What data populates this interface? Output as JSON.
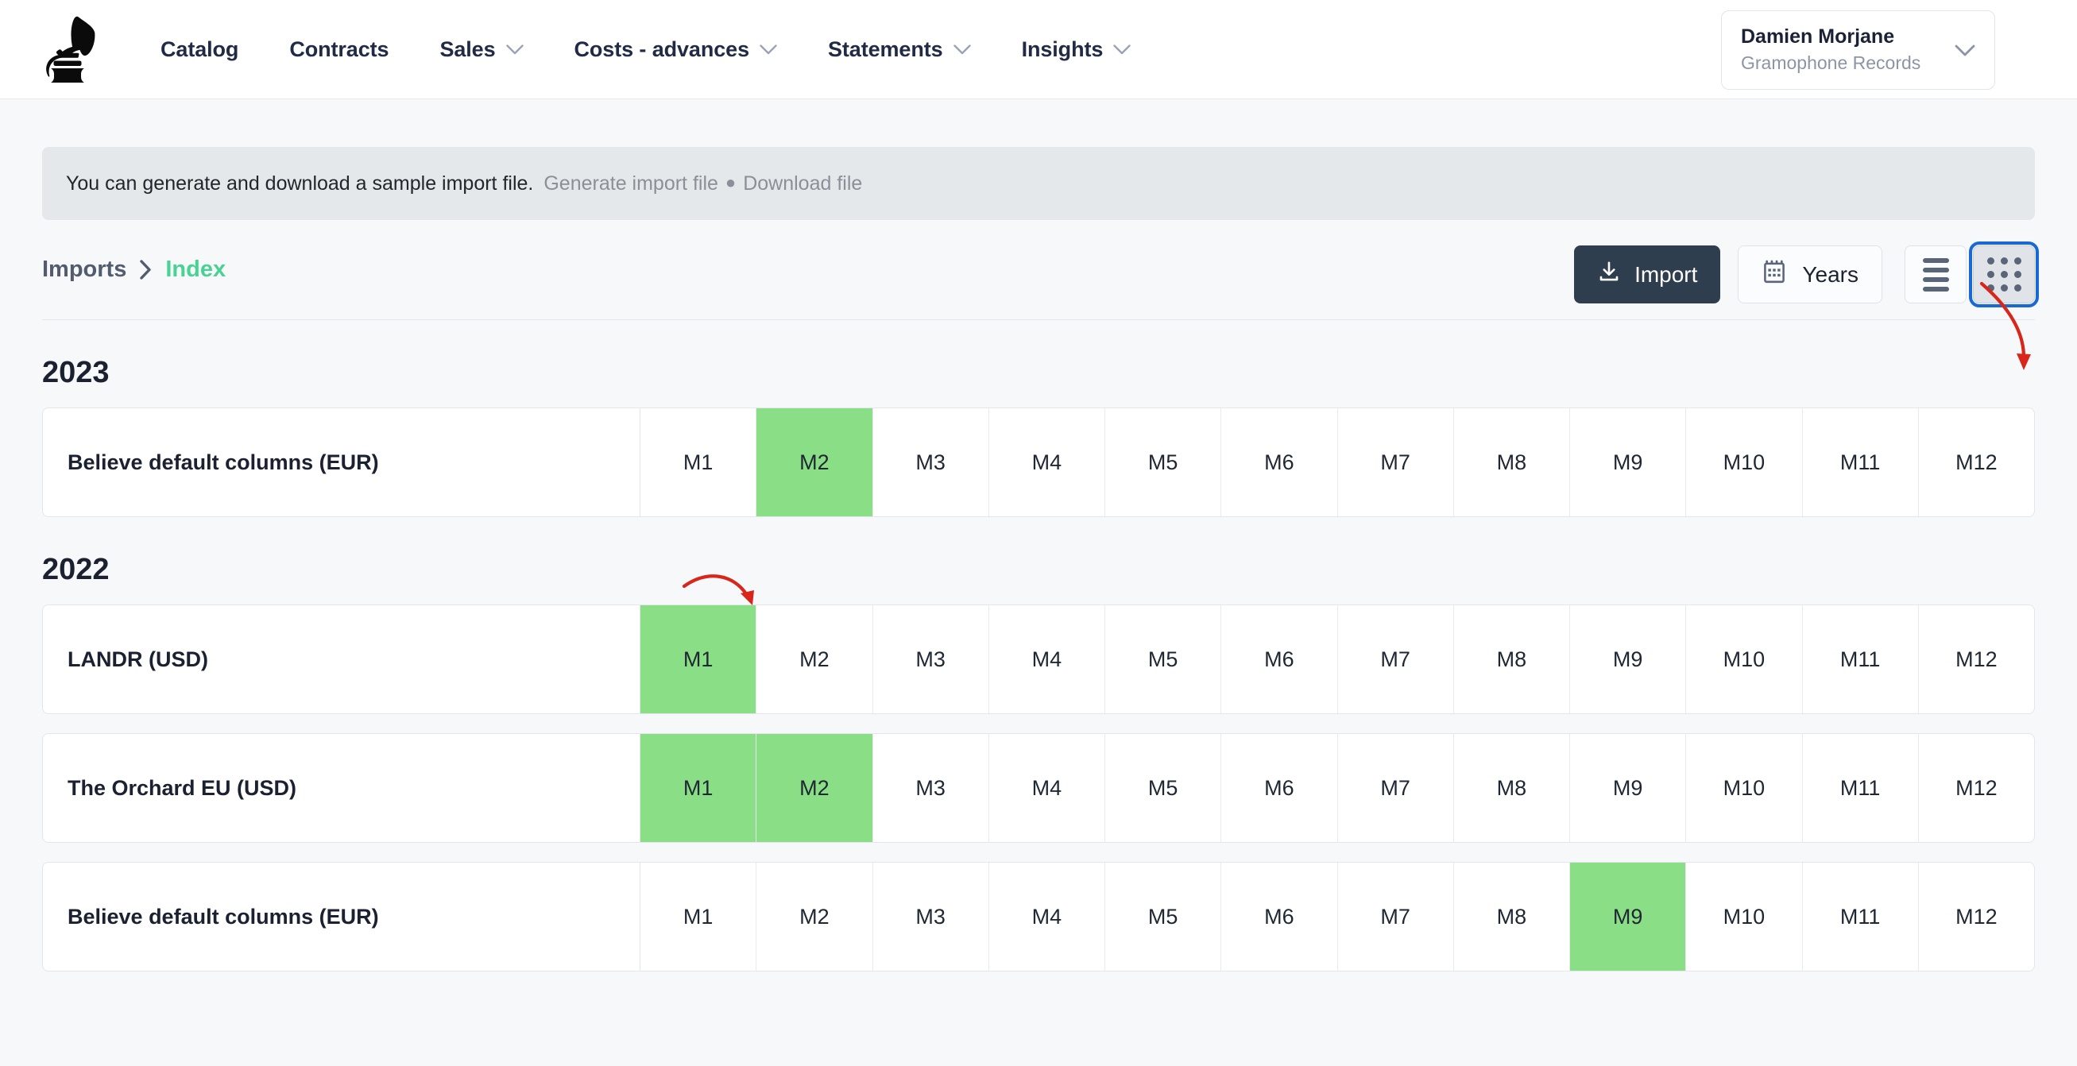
{
  "header": {
    "logo_icon": "gramophone-logo",
    "nav": [
      {
        "label": "Catalog",
        "has_caret": false
      },
      {
        "label": "Contracts",
        "has_caret": false
      },
      {
        "label": "Sales",
        "has_caret": true
      },
      {
        "label": "Costs - advances",
        "has_caret": true
      },
      {
        "label": "Statements",
        "has_caret": true
      },
      {
        "label": "Insights",
        "has_caret": true
      }
    ],
    "user": {
      "name": "Damien Morjane",
      "organization": "Gramophone Records",
      "caret_icon": "chevron-down-icon"
    }
  },
  "banner": {
    "message": "You can generate and download a sample import file.",
    "generate_link": "Generate import file",
    "separator": "●",
    "download_link": "Download file"
  },
  "breadcrumb": {
    "root": "Imports",
    "separator_icon": "chevron-right-icon",
    "current": "Index"
  },
  "toolbar": {
    "import_label": "Import",
    "import_icon": "download-icon",
    "years_label": "Years",
    "years_icon": "calendar-icon",
    "list_view_icon": "list-view-icon",
    "grid_view_icon": "grid-view-icon",
    "grid_view_selected": true
  },
  "colors": {
    "accent_green": "#4ad295",
    "cell_highlight": "#8ade86",
    "import_button": "#2e3e4e",
    "focus_ring": "#1869d4",
    "annotation_red": "#d8271a",
    "banner_bg": "#e5e8eb"
  },
  "months": [
    "M1",
    "M2",
    "M3",
    "M4",
    "M5",
    "M6",
    "M7",
    "M8",
    "M9",
    "M10",
    "M11",
    "M12"
  ],
  "years": [
    {
      "year": "2023",
      "rows": [
        {
          "label": "Believe default columns (EUR)",
          "active_months": [
            "M2"
          ]
        }
      ]
    },
    {
      "year": "2022",
      "rows": [
        {
          "label": "LANDR (USD)",
          "active_months": [
            "M1"
          ]
        },
        {
          "label": "The Orchard EU (USD)",
          "active_months": [
            "M1",
            "M2"
          ]
        },
        {
          "label": "Believe default columns (EUR)",
          "active_months": [
            "M9"
          ]
        }
      ]
    }
  ],
  "annotations": [
    {
      "name": "arrow-to-grid-view",
      "target": "grid-view-button"
    },
    {
      "name": "arrow-to-m2-cell",
      "target": "month-cell-m2-2023"
    }
  ]
}
